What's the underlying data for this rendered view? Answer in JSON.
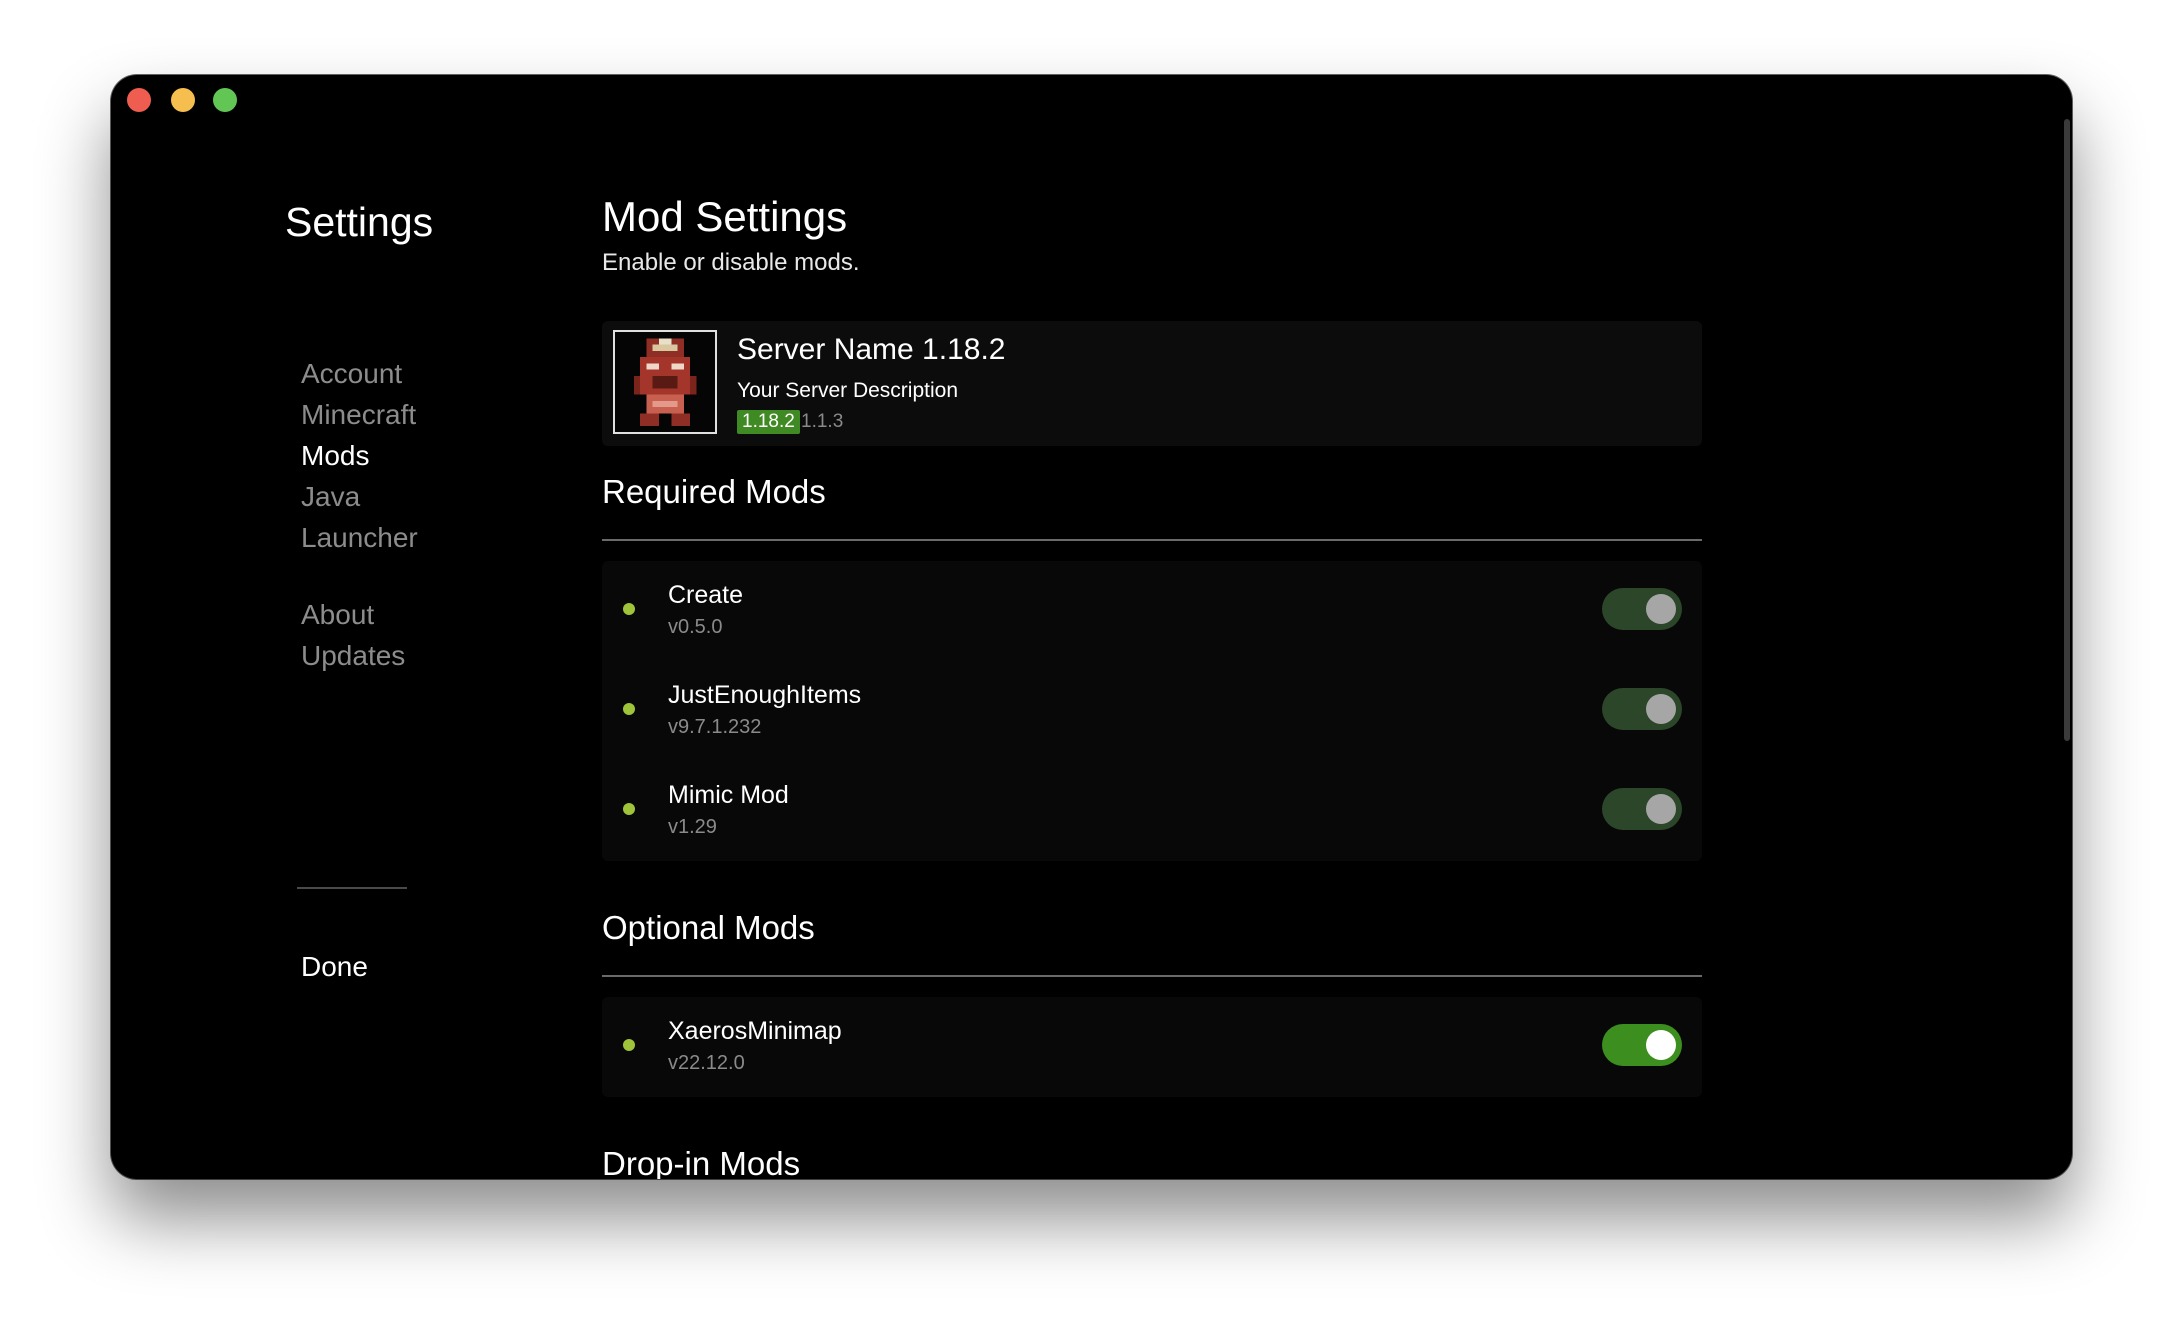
{
  "sidebar": {
    "title": "Settings",
    "items": [
      {
        "label": "Account",
        "active": false
      },
      {
        "label": "Minecraft",
        "active": false
      },
      {
        "label": "Mods",
        "active": true
      },
      {
        "label": "Java",
        "active": false
      },
      {
        "label": "Launcher",
        "active": false
      },
      {
        "label": "About",
        "active": false
      },
      {
        "label": "Updates",
        "active": false
      }
    ],
    "done_label": "Done"
  },
  "main": {
    "title": "Mod Settings",
    "subtitle": "Enable or disable mods.",
    "server": {
      "name": "Server Name 1.18.2",
      "description": "Your Server Description",
      "mc_version": "1.18.2",
      "loader_version": "1.1.3",
      "icon": "pixel-mob-face-icon"
    },
    "required_mods": {
      "title": "Required Mods",
      "mods": [
        {
          "name": "Create",
          "version": "v0.5.0",
          "enabled": true,
          "locked": true
        },
        {
          "name": "JustEnoughItems",
          "version": "v9.7.1.232",
          "enabled": true,
          "locked": true
        },
        {
          "name": "Mimic Mod",
          "version": "v1.29",
          "enabled": true,
          "locked": true
        }
      ]
    },
    "optional_mods": {
      "title": "Optional Mods",
      "mods": [
        {
          "name": "XaerosMinimap",
          "version": "v22.12.0",
          "enabled": true,
          "locked": false
        }
      ]
    },
    "dropin_mods": {
      "title": "Drop-in Mods"
    }
  },
  "colors": {
    "accent_green": "#3c8f1f",
    "locked_toggle": "#2c4629",
    "status_dot": "#9fc43a",
    "badge_green": "#3f8a23"
  }
}
